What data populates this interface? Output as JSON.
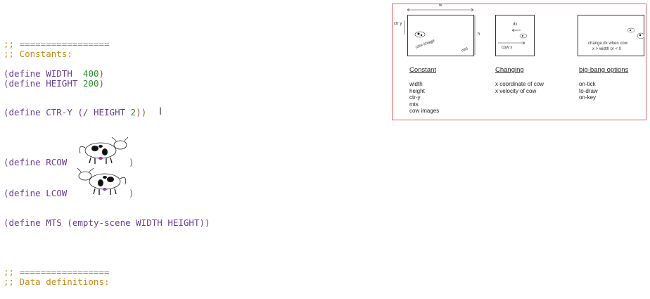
{
  "code": {
    "comment_rule_1": ";; =================",
    "comment_constants": ";; Constants:",
    "define_kw": "(define",
    "width_name": "WIDTH",
    "width_value": "400",
    "height_name": "HEIGHT",
    "height_value": "200",
    "ctry_name": "CTR-Y",
    "ctry_expr_open": "(/ HEIGHT",
    "ctry_expr_num": "2",
    "ctry_close": "))",
    "rcow_name": "RCOW",
    "lcow_name": "LCOW",
    "mts_name": "MTS",
    "mts_expr": "(empty-scene WIDTH HEIGHT))",
    "close_paren": ")",
    "comment_rule_2": ";; =================",
    "comment_data": ";; Data definitions:"
  },
  "diagram": {
    "box1": {
      "top_label": "w",
      "side_left": "ctr y",
      "side_right": "h",
      "inner_image": "cow image",
      "inner_mts": "mts"
    },
    "box2": {
      "dx_label": "dx",
      "cowx_label": "cow x"
    },
    "box3": {
      "note_line1": "change dx when cow",
      "note_line2": "x > width  or < 0"
    },
    "columns": [
      {
        "heading": "Constant",
        "items": [
          "width",
          "height",
          "ctr-y",
          "mts",
          "cow images"
        ]
      },
      {
        "heading": "Changing",
        "items": [
          "x coordinate of cow",
          "x velocity of cow"
        ]
      },
      {
        "heading": "big-bang options",
        "items": [
          "on-tick",
          "to-draw",
          "on-key"
        ]
      }
    ]
  },
  "colors": {
    "keyword": "#6a3d95",
    "number": "#2e8b2e",
    "comment": "#c28a1a",
    "panel_border": "#e06464"
  }
}
